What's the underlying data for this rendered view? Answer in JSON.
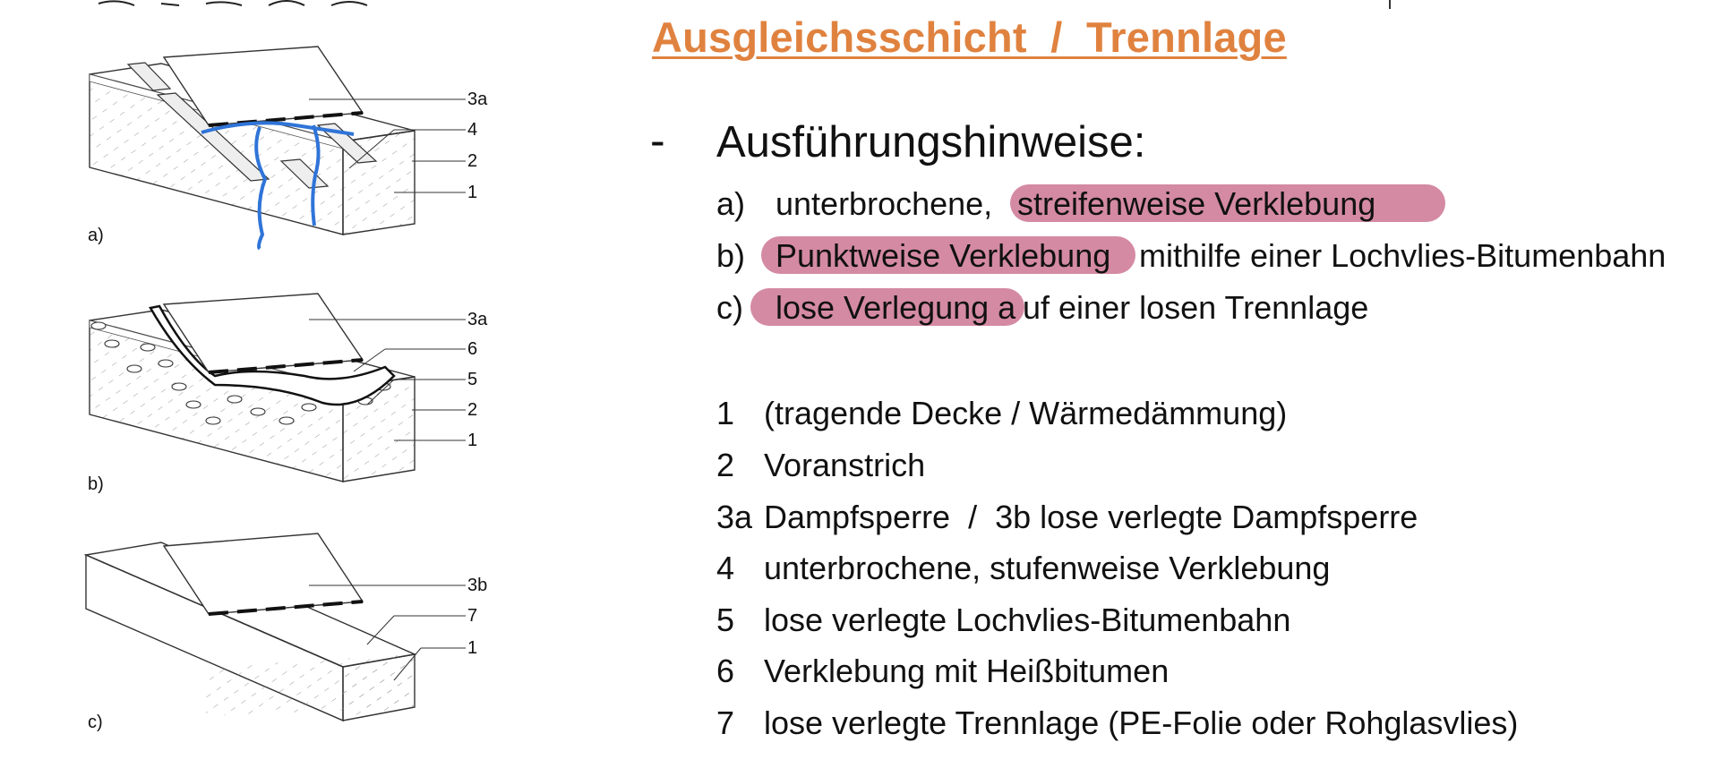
{
  "title": "Ausgleichsschicht  /  Trennlage",
  "section": {
    "bullet": "-",
    "heading": "Ausführungshinweise:"
  },
  "items": [
    {
      "letter": "a)",
      "pre": "unterbrochene,",
      "highlight": "streifenweise Verklebung",
      "post": ""
    },
    {
      "letter": "b)",
      "pre": "",
      "highlight": "Punktweise Verklebung",
      "post": "mithilfe einer Lochvlies-Bitumenbahn"
    },
    {
      "letter": "c)",
      "pre": "",
      "highlight": "lose Verlegung a",
      "post": "uf einer losen Trennlage"
    }
  ],
  "highlight_color": "#d48aa3",
  "title_color": "#e0823f",
  "legend": [
    {
      "num": "1",
      "text": "(tragende Decke / Wärmedämmung)"
    },
    {
      "num": "2",
      "text": "Voranstrich"
    },
    {
      "num": "3a",
      "text": "Dampfsperre  /  3b lose verlegte Dampfsperre"
    },
    {
      "num": "4",
      "text": "unterbrochene, stufenweise Verklebung"
    },
    {
      "num": "5",
      "text": "lose verlegte Lochvlies-Bitumenbahn"
    },
    {
      "num": "6",
      "text": "Verklebung mit Heißbitumen"
    },
    {
      "num": "7",
      "text": "lose verlegte Trennlage (PE-Folie oder Rohglasvlies)"
    }
  ],
  "figure": {
    "a": {
      "label": "a)",
      "callouts": [
        "3a",
        "4",
        "2",
        "1"
      ]
    },
    "b": {
      "label": "b)",
      "callouts": [
        "3a",
        "6",
        "5",
        "2",
        "1"
      ]
    },
    "c": {
      "label": "c)",
      "callouts": [
        "3b",
        "7",
        "1"
      ]
    },
    "annotation_color": "#2f74d8"
  }
}
